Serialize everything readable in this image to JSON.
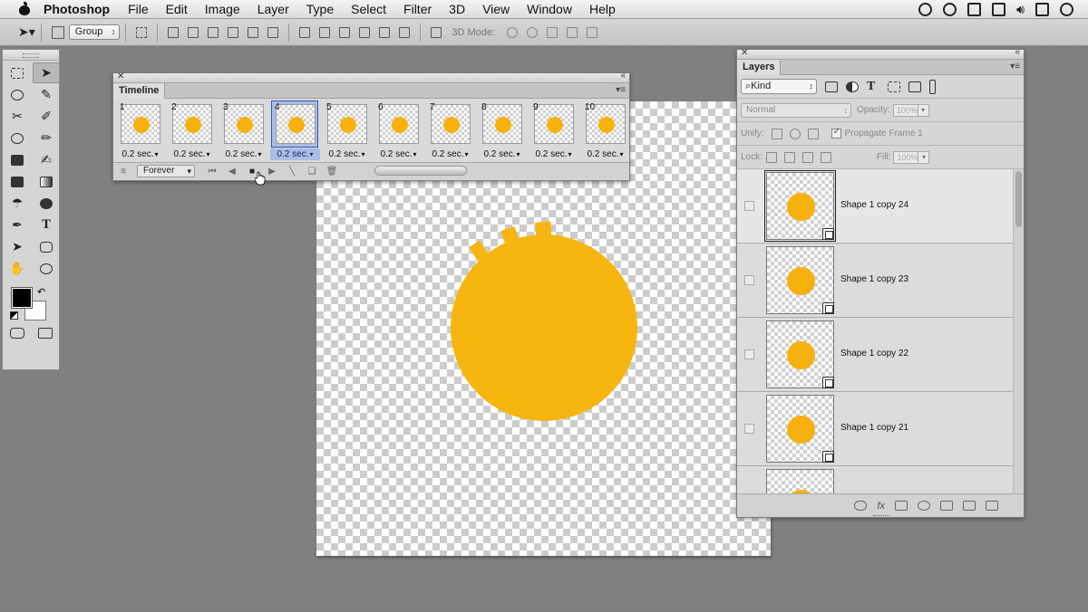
{
  "menubar": {
    "app_name": "Photoshop",
    "items": [
      "File",
      "Edit",
      "Image",
      "Layer",
      "Type",
      "Select",
      "Filter",
      "3D",
      "View",
      "Window",
      "Help"
    ]
  },
  "options_bar": {
    "auto_select_value": "Group",
    "mode_label": "3D Mode:"
  },
  "timeline": {
    "tab_label": "Timeline",
    "selected_frame": 4,
    "frames": [
      {
        "number": "1",
        "delay": "0.2 sec."
      },
      {
        "number": "2",
        "delay": "0.2 sec."
      },
      {
        "number": "3",
        "delay": "0.2 sec."
      },
      {
        "number": "4",
        "delay": "0.2 sec."
      },
      {
        "number": "5",
        "delay": "0.2 sec."
      },
      {
        "number": "6",
        "delay": "0.2 sec."
      },
      {
        "number": "7",
        "delay": "0.2 sec."
      },
      {
        "number": "8",
        "delay": "0.2 sec."
      },
      {
        "number": "9",
        "delay": "0.2 sec."
      },
      {
        "number": "10",
        "delay": "0.2 sec."
      }
    ],
    "loop_value": "Forever"
  },
  "layers_panel": {
    "tab_label": "Layers",
    "filter_kind": "Kind",
    "blend_mode": "Normal",
    "opacity_label": "Opacity:",
    "opacity_value": "100%",
    "unify_label": "Unify:",
    "propagate_label": "Propagate Frame 1",
    "lock_label": "Lock:",
    "fill_label": "Fill:",
    "fill_value": "100%",
    "layers": [
      {
        "name": "Shape 1 copy 24"
      },
      {
        "name": "Shape 1 copy 23"
      },
      {
        "name": "Shape 1 copy 22"
      },
      {
        "name": "Shape 1 copy 21"
      },
      {
        "name": ""
      }
    ]
  },
  "colors": {
    "shape_fill": "#f7b510",
    "selection_blue": "#a9bde3",
    "foreground": "#000000",
    "background": "#ffffff"
  }
}
